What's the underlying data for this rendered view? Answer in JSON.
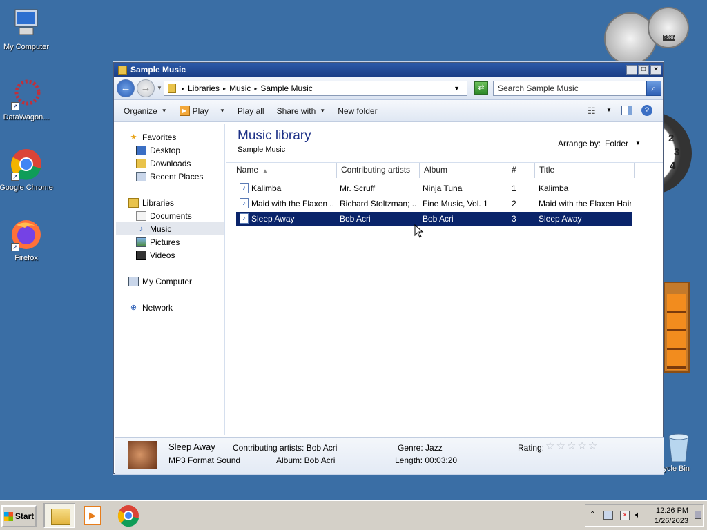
{
  "desktop": {
    "icons": [
      {
        "label": "My Computer",
        "icon": "computer-icon"
      },
      {
        "label": "DataWagon...",
        "icon": "datawagon-icon"
      },
      {
        "label": "Google Chrome",
        "icon": "chrome-icon"
      },
      {
        "label": "Firefox",
        "icon": "firefox-icon"
      },
      {
        "label": "cycle Bin",
        "icon": "recycle-bin-icon"
      }
    ],
    "gadgets": {
      "cpu_meter_percent": "33%"
    }
  },
  "window": {
    "title": "Sample Music",
    "controls": {
      "minimize": "_",
      "maximize": "□",
      "close": "×"
    },
    "address": {
      "path": [
        "Libraries",
        "Music",
        "Sample Music"
      ]
    },
    "search": {
      "placeholder": "Search Sample Music"
    },
    "toolbar": {
      "organize": "Organize",
      "play": "Play",
      "play_all": "Play all",
      "share_with": "Share with",
      "new_folder": "New folder"
    },
    "nav": {
      "favorites": "Favorites",
      "desktop": "Desktop",
      "downloads": "Downloads",
      "recent_places": "Recent Places",
      "libraries": "Libraries",
      "documents": "Documents",
      "music": "Music",
      "pictures": "Pictures",
      "videos": "Videos",
      "my_computer": "My Computer",
      "network": "Network"
    },
    "library": {
      "title": "Music library",
      "subtitle": "Sample Music",
      "arrange_label": "Arrange by:",
      "arrange_value": "Folder"
    },
    "columns": {
      "name": "Name",
      "artists": "Contributing artists",
      "album": "Album",
      "num": "#",
      "title": "Title"
    },
    "rows": [
      {
        "name": "Kalimba",
        "artist": "Mr. Scruff",
        "album": "Ninja Tuna",
        "num": "1",
        "title": "Kalimba"
      },
      {
        "name": "Maid with the Flaxen ...",
        "artist": "Richard Stoltzman; ...",
        "album": "Fine Music, Vol. 1",
        "num": "2",
        "title": "Maid with the Flaxen Hair"
      },
      {
        "name": "Sleep Away",
        "artist": "Bob Acri",
        "album": "Bob Acri",
        "num": "3",
        "title": "Sleep Away"
      }
    ],
    "details": {
      "track": "Sleep Away",
      "format": "MP3 Format Sound",
      "artists": "Contributing artists: Bob Acri",
      "album": "Album: Bob Acri",
      "genre": "Genre: Jazz",
      "length": "Length: 00:03:20",
      "rating_label": "Rating:",
      "rating_stars": 0
    }
  },
  "taskbar": {
    "start": "Start",
    "time": "12:26 PM",
    "date": "1/26/2023"
  },
  "colors": {
    "desktop": "#3a6ea5",
    "selection": "#0a246a"
  }
}
